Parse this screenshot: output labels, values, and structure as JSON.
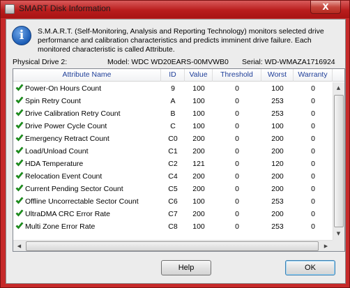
{
  "window": {
    "title": "SMART Disk Information",
    "close_glyph": "X"
  },
  "info": {
    "icon": "info-icon",
    "glyph": "i",
    "text": "S.M.A.R.T. (Self-Monitoring, Analysis and Reporting Technology) monitors selected drive performance and calibration characteristics and predicts imminent drive failure. Each monitored characteristic is called Attribute."
  },
  "drive": {
    "label": "Physical Drive 2:",
    "model": "Model: WDC WD20EARS-00MVWB0",
    "serial": "Serial: WD-WMAZA1716924"
  },
  "table": {
    "columns": [
      "Attribute Name",
      "ID",
      "Value",
      "Threshold",
      "Worst",
      "Warranty"
    ],
    "rows": [
      [
        "Power-On Hours Count",
        "9",
        "100",
        "0",
        "100",
        "0"
      ],
      [
        "Spin Retry Count",
        "A",
        "100",
        "0",
        "253",
        "0"
      ],
      [
        "Drive Calibration Retry Count",
        "B",
        "100",
        "0",
        "253",
        "0"
      ],
      [
        "Drive Power Cycle Count",
        "C",
        "100",
        "0",
        "100",
        "0"
      ],
      [
        "Emergency Retract Count",
        "C0",
        "200",
        "0",
        "200",
        "0"
      ],
      [
        "Load/Unload Count",
        "C1",
        "200",
        "0",
        "200",
        "0"
      ],
      [
        "HDA Temperature",
        "C2",
        "121",
        "0",
        "120",
        "0"
      ],
      [
        "Relocation Event Count",
        "C4",
        "200",
        "0",
        "200",
        "0"
      ],
      [
        "Current Pending Sector Count",
        "C5",
        "200",
        "0",
        "200",
        "0"
      ],
      [
        "Offline Uncorrectable Sector Count",
        "C6",
        "100",
        "0",
        "253",
        "0"
      ],
      [
        "UltraDMA CRC Error Rate",
        "C7",
        "200",
        "0",
        "200",
        "0"
      ],
      [
        "Multi Zone Error Rate",
        "C8",
        "100",
        "0",
        "253",
        "0"
      ]
    ],
    "status_icon": "green-check-icon",
    "status_color": "#1e9c1e",
    "header_text_color": "#1e3e99"
  },
  "buttons": {
    "help": "Help",
    "ok": "OK"
  }
}
